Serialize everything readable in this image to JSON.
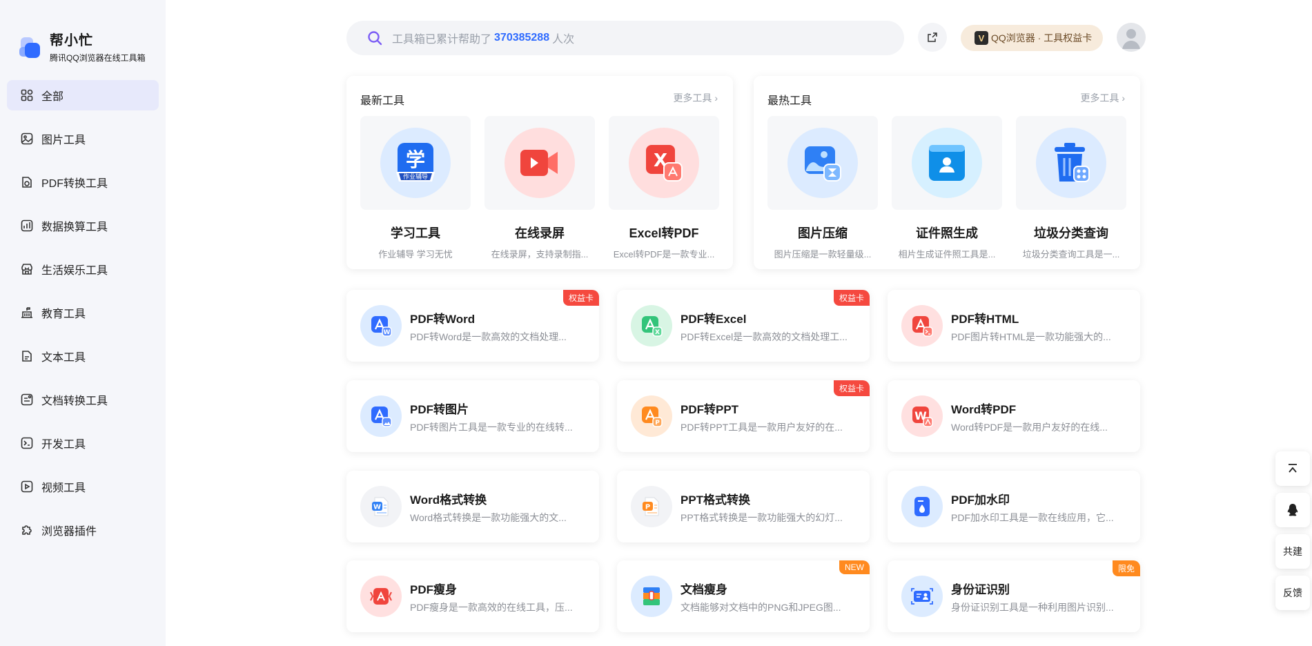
{
  "sidebar": {
    "logo_title": "帮小忙",
    "logo_subtitle": "腾讯QQ浏览器在线工具箱",
    "items": [
      {
        "label": "全部",
        "icon": "grid-icon",
        "active": true
      },
      {
        "label": "图片工具",
        "icon": "image-icon"
      },
      {
        "label": "PDF转换工具",
        "icon": "pdf-icon"
      },
      {
        "label": "数据换算工具",
        "icon": "chart-icon"
      },
      {
        "label": "生活娱乐工具",
        "icon": "store-icon"
      },
      {
        "label": "教育工具",
        "icon": "school-icon"
      },
      {
        "label": "文本工具",
        "icon": "text-file-icon"
      },
      {
        "label": "文档转换工具",
        "icon": "doc-convert-icon"
      },
      {
        "label": "开发工具",
        "icon": "terminal-icon"
      },
      {
        "label": "视频工具",
        "icon": "video-icon"
      },
      {
        "label": "浏览器插件",
        "icon": "puzzle-icon"
      }
    ]
  },
  "header": {
    "search_prefix": "工具箱已累计帮助了",
    "search_count": "370385288",
    "search_suffix": "人次",
    "vip_label": "QQ浏览器 · 工具权益卡"
  },
  "newest": {
    "title": "最新工具",
    "more": "更多工具",
    "items": [
      {
        "name": "学习工具",
        "desc": "作业辅导 学习无忧"
      },
      {
        "name": "在线录屏",
        "desc": "在线录屏，支持录制指..."
      },
      {
        "name": "Excel转PDF",
        "desc": "Excel转PDF是一款专业..."
      }
    ]
  },
  "hottest": {
    "title": "最热工具",
    "more": "更多工具",
    "items": [
      {
        "name": "图片压缩",
        "desc": "图片压缩是一款轻量级..."
      },
      {
        "name": "证件照生成",
        "desc": "相片生成证件照工具是..."
      },
      {
        "name": "垃圾分类查询",
        "desc": "垃圾分类查询工具是一..."
      }
    ]
  },
  "tools": [
    {
      "title": "PDF转Word",
      "desc": "PDF转Word是一款高效的文档处理...",
      "badge": "权益卡"
    },
    {
      "title": "PDF转Excel",
      "desc": "PDF转Excel是一款高效的文档处理工...",
      "badge": "权益卡"
    },
    {
      "title": "PDF转HTML",
      "desc": "PDF图片转HTML是一款功能强大的..."
    },
    {
      "title": "PDF转图片",
      "desc": "PDF转图片工具是一款专业的在线转..."
    },
    {
      "title": "PDF转PPT",
      "desc": "PDF转PPT工具是一款用户友好的在...",
      "badge": "权益卡"
    },
    {
      "title": "Word转PDF",
      "desc": "Word转PDF是一款用户友好的在线..."
    },
    {
      "title": "Word格式转换",
      "desc": "Word格式转换是一款功能强大的文..."
    },
    {
      "title": "PPT格式转换",
      "desc": "PPT格式转换是一款功能强大的幻灯..."
    },
    {
      "title": "PDF加水印",
      "desc": "PDF加水印工具是一款在线应用，它..."
    },
    {
      "title": "PDF瘦身",
      "desc": "PDF瘦身是一款高效的在线工具，压..."
    },
    {
      "title": "文档瘦身",
      "desc": "文档能够对文档中的PNG和JPEG图...",
      "badge": "NEW"
    },
    {
      "title": "身份证识别",
      "desc": "身份证识别工具是一种利用图片识别...",
      "badge": "限免"
    }
  ],
  "float": {
    "cobuild": "共建",
    "feedback": "反馈"
  },
  "colors": {
    "accent": "#2f6bff",
    "badge_red": "#f5493f",
    "badge_orange": "#ff8a1f"
  }
}
